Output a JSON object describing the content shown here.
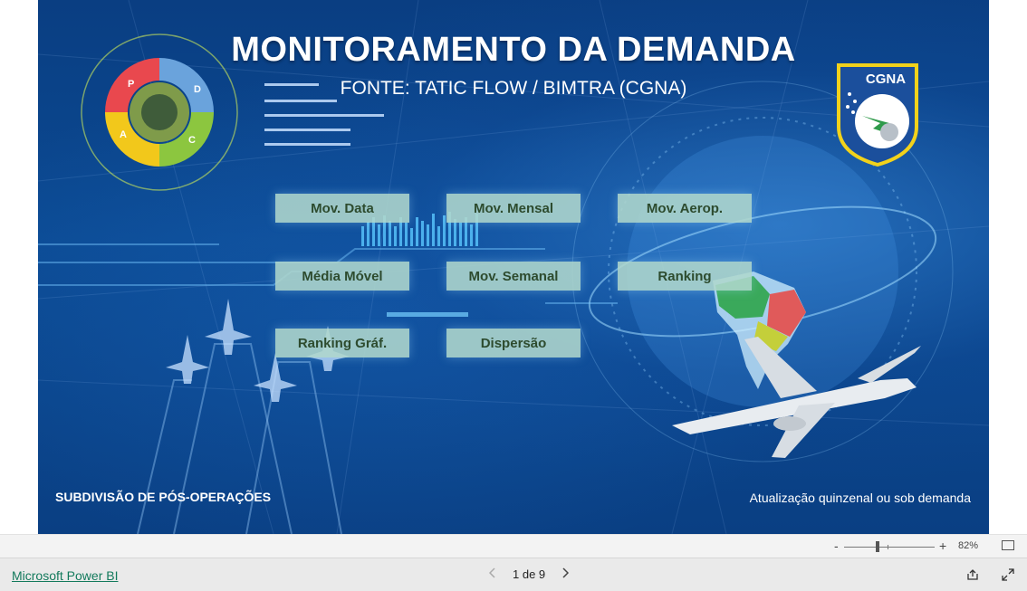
{
  "report": {
    "title": "MONITORAMENTO DA DEMANDA",
    "subtitle": "FONTE: TATIC FLOW / BIMTRA (CGNA)",
    "logo_text": "CGNA",
    "pdca_letters": [
      "P",
      "D",
      "C",
      "A"
    ],
    "footer_left": "SUBDIVISÃO DE PÓS-OPERAÇÕES",
    "footer_right": "Atualização quinzenal ou sob demanda"
  },
  "nav_buttons": [
    {
      "label": "Mov. Data"
    },
    {
      "label": "Mov. Mensal"
    },
    {
      "label": "Mov. Aerop."
    },
    {
      "label": "Média Móvel"
    },
    {
      "label": "Mov. Semanal"
    },
    {
      "label": "Ranking"
    },
    {
      "label": "Ranking Gráf."
    },
    {
      "label": "Dispersão"
    }
  ],
  "zoom": {
    "minus": "-",
    "plus": "+",
    "value": "82%",
    "level_percent": 82
  },
  "statusbar": {
    "brand_link": "Microsoft Power BI",
    "page_indicator": "1 de 9",
    "prev_icon": "chevron-left-icon",
    "next_icon": "chevron-right-icon",
    "share_icon": "share-icon",
    "fullscreen_icon": "expand-icon"
  },
  "colors": {
    "background": "#0b4a93",
    "button_fill": "#afd7cd",
    "button_text": "#2d4b2e",
    "link": "#137a5c",
    "logo_border": "#f2d21b"
  }
}
